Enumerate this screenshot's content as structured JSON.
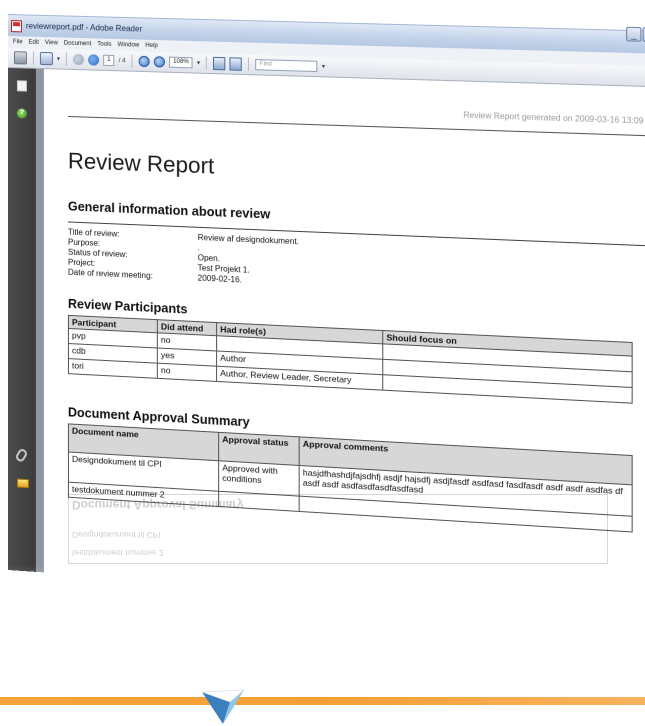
{
  "window": {
    "title": "reviewreport.pdf - Adobe Reader",
    "controls": [
      "_",
      "□",
      "×"
    ],
    "doc_close": "×"
  },
  "menu": [
    "File",
    "Edit",
    "View",
    "Document",
    "Tools",
    "Window",
    "Help"
  ],
  "toolbar": {
    "page_current": "1",
    "page_total": "/ 4",
    "zoom": "108%",
    "find_placeholder": "Find"
  },
  "document": {
    "header": "Review Report generated on 2009-03-16 13:09",
    "title": "Review Report",
    "general": {
      "heading": "General information about review",
      "rows": [
        {
          "label": "Title of review:",
          "value": "Review af designdokument."
        },
        {
          "label": "Purpose:",
          "value": "."
        },
        {
          "label": "Status of review:",
          "value": "Open."
        },
        {
          "label": "Project:",
          "value": "Test Projekt 1."
        },
        {
          "label": "Date of review meeting:",
          "value": "2009-02-16."
        }
      ]
    },
    "participants": {
      "heading": "Review Participants",
      "columns": [
        "Participant",
        "Did attend",
        "Had role(s)",
        "Should focus on"
      ],
      "rows": [
        [
          "pvp",
          "no",
          "",
          ""
        ],
        [
          "cdb",
          "yes",
          "Author",
          ""
        ],
        [
          "tori",
          "no",
          "Author, Review Leader, Secretary",
          ""
        ]
      ]
    },
    "approval": {
      "heading": "Document Approval Summary",
      "columns": [
        "Document name",
        "Approval status",
        "Approval comments"
      ],
      "rows": [
        [
          "Designdokument til CPI",
          "Approved with conditions",
          "hasjdfhashdjfajsdhfj asdjf hajsdfj asdjfasdf asdfasd fasdfasdf asdf asdf asdfas df asdf asdf asdfasdfasdfasdfasd"
        ],
        [
          "testdokument nummer 2",
          "",
          ""
        ]
      ]
    }
  },
  "colors": {
    "accent_orange": "#f7a23a",
    "titlebar_blue": "#c3d3ea",
    "nav_dark": "#3b3b3b"
  }
}
